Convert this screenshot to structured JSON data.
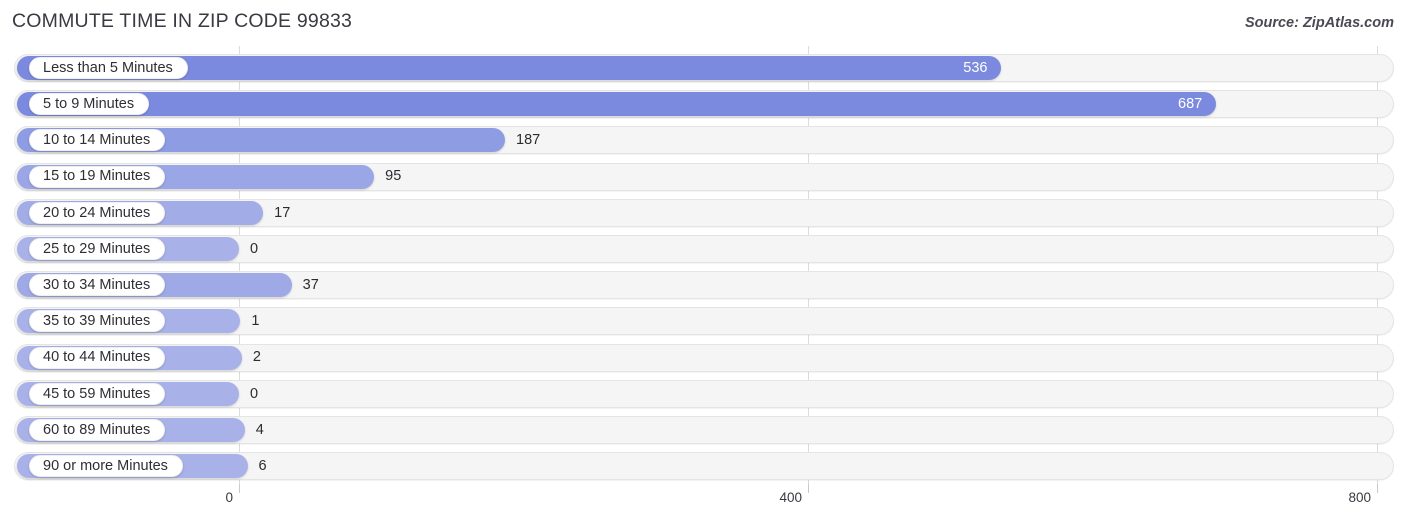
{
  "header": {
    "title": "COMMUTE TIME IN ZIP CODE 99833",
    "source": "Source: ZipAtlas.com"
  },
  "colors": {
    "bar_strong": "#7b8ade",
    "bar_medium": "#8e9ce4",
    "bar_light": "#a8b2e8",
    "track": "#f5f5f5",
    "track_border": "#e4e4e4",
    "grid": "#dcdcdc",
    "title_text": "#3a3a42",
    "value_inside_text": "#ffffff",
    "value_outside_text": "#2b2b31"
  },
  "chart_data": {
    "type": "bar",
    "orientation": "horizontal",
    "title": "COMMUTE TIME IN ZIP CODE 99833",
    "xlabel": "",
    "ylabel": "",
    "xlim": [
      0,
      800
    ],
    "ticks": [
      "0",
      "400",
      "800"
    ],
    "tick_values": [
      0,
      400,
      800
    ],
    "grid": true,
    "legend": "none",
    "categories": [
      "Less than 5 Minutes",
      "5 to 9 Minutes",
      "10 to 14 Minutes",
      "15 to 19 Minutes",
      "20 to 24 Minutes",
      "25 to 29 Minutes",
      "30 to 34 Minutes",
      "35 to 39 Minutes",
      "40 to 44 Minutes",
      "45 to 59 Minutes",
      "60 to 89 Minutes",
      "90 or more Minutes"
    ],
    "values": [
      536,
      687,
      187,
      95,
      17,
      0,
      37,
      1,
      2,
      0,
      4,
      6
    ],
    "value_labels": [
      "536",
      "687",
      "187",
      "95",
      "17",
      "0",
      "37",
      "1",
      "2",
      "0",
      "4",
      "6"
    ]
  },
  "rows": [
    {
      "label": "Less than 5 Minutes",
      "value": 536,
      "value_label": "536",
      "inside": true,
      "color": "#7b8ade"
    },
    {
      "label": "5 to 9 Minutes",
      "value": 687,
      "value_label": "687",
      "inside": true,
      "color": "#7b8ade"
    },
    {
      "label": "10 to 14 Minutes",
      "value": 187,
      "value_label": "187",
      "inside": false,
      "color": "#8e9ce4"
    },
    {
      "label": "15 to 19 Minutes",
      "value": 95,
      "value_label": "95",
      "inside": false,
      "color": "#9aa6e6"
    },
    {
      "label": "20 to 24 Minutes",
      "value": 17,
      "value_label": "17",
      "inside": false,
      "color": "#a2ace7"
    },
    {
      "label": "25 to 29 Minutes",
      "value": 0,
      "value_label": "0",
      "inside": false,
      "color": "#a8b2e8"
    },
    {
      "label": "30 to 34 Minutes",
      "value": 37,
      "value_label": "37",
      "inside": false,
      "color": "#9ea9e6"
    },
    {
      "label": "35 to 39 Minutes",
      "value": 1,
      "value_label": "1",
      "inside": false,
      "color": "#a8b2e8"
    },
    {
      "label": "40 to 44 Minutes",
      "value": 2,
      "value_label": "2",
      "inside": false,
      "color": "#a8b2e8"
    },
    {
      "label": "45 to 59 Minutes",
      "value": 0,
      "value_label": "0",
      "inside": false,
      "color": "#a8b2e8"
    },
    {
      "label": "60 to 89 Minutes",
      "value": 4,
      "value_label": "4",
      "inside": false,
      "color": "#a8b2e8"
    },
    {
      "label": "90 or more Minutes",
      "value": 6,
      "value_label": "6",
      "inside": false,
      "color": "#a8b2e8"
    }
  ],
  "axis": {
    "ticks": [
      {
        "label": "0",
        "value": 0
      },
      {
        "label": "400",
        "value": 400
      },
      {
        "label": "800",
        "value": 800
      }
    ]
  }
}
